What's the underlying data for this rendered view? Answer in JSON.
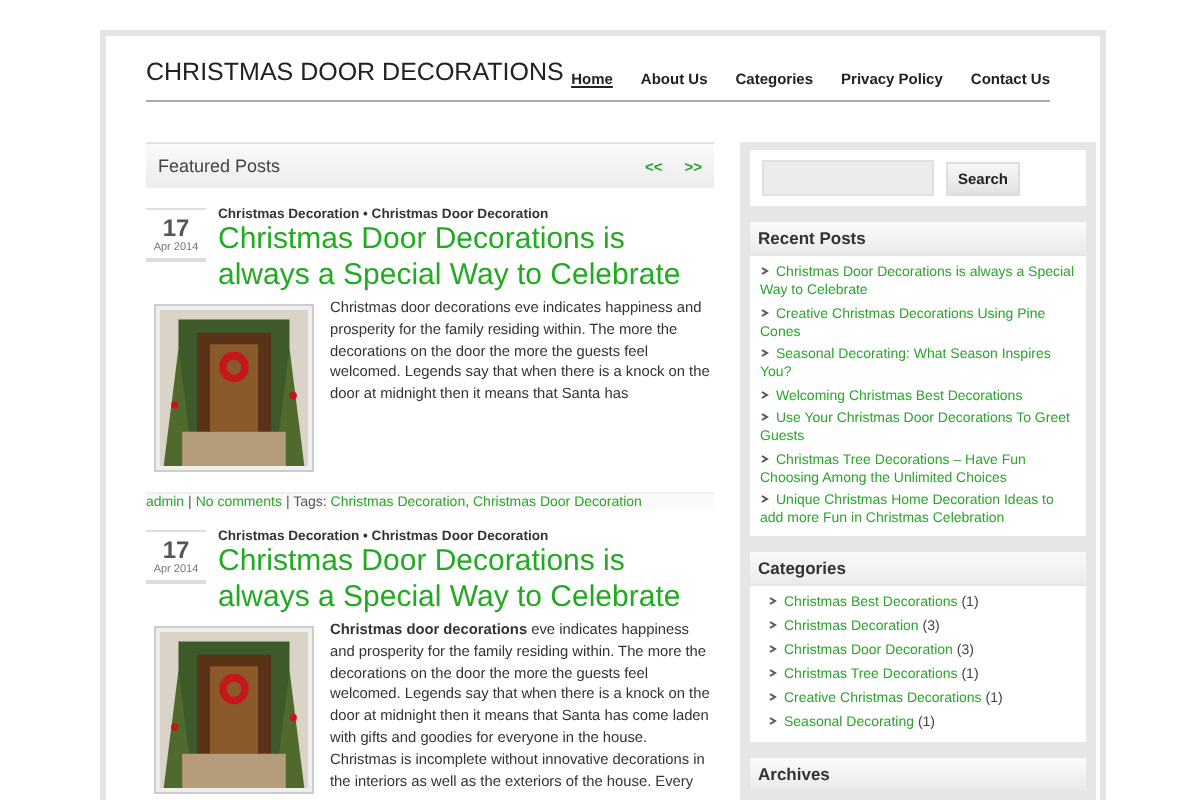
{
  "site_title": "CHRISTMAS DOOR DECORATIONS",
  "nav": [
    {
      "label": "Home",
      "selected": true
    },
    {
      "label": "About Us",
      "selected": false
    },
    {
      "label": "Categories",
      "selected": false
    },
    {
      "label": "Privacy Policy",
      "selected": false
    },
    {
      "label": "Contact Us",
      "selected": false
    }
  ],
  "featured": {
    "title": "Featured Posts",
    "prev": "<<",
    "next": ">>"
  },
  "posts": [
    {
      "day": "17",
      "month": "Apr 2014",
      "categories": [
        "Christmas Decoration",
        "Christmas Door Decoration"
      ],
      "separator": "•",
      "title": "Christmas Door Decorations is always a Special Way to Celebrate",
      "excerpt": "Christmas door decorations eve indicates happiness and prosperity for the family residing within. The more the decorations on the door the more the guests feel welcomed. Legends say that when there is a knock on the door at midnight then it means that Santa has",
      "meta": {
        "author": "admin",
        "separator": "|",
        "comments": "No comments",
        "tags_label": "| Tags:",
        "tags": [
          "Christmas Decoration",
          "Christmas Door Decoration"
        ],
        "tag_separator": ","
      }
    },
    {
      "day": "17",
      "month": "Apr 2014",
      "categories": [
        "Christmas Decoration",
        "Christmas Door Decoration"
      ],
      "separator": "•",
      "title": "Christmas Door Decorations is always a Special Way to Celebrate",
      "excerpt": "**Christmas door decorations** eve indicates happiness and prosperity for the family residing within. The more the decorations on the door the more the guests feel welcomed. Legends say that when there is a knock on the door at midnight then it means that Santa has come laden with gifts and goodies for everyone in the house. Christmas is incomplete without innovative decorations in the interiors as well as the exteriors of the house. Every"
    }
  ],
  "sidebar": {
    "search_button": "Search",
    "recent_posts": {
      "title": "Recent Posts",
      "items": [
        "Christmas Door Decorations is always a Special Way to Celebrate",
        "Creative Christmas Decorations Using Pine Cones",
        "Seasonal Decorating: What Season Inspires You?",
        "Welcoming Christmas Best Decorations",
        "Use Your Christmas Door Decorations To Greet Guests",
        "Christmas Tree Decorations – Have Fun Choosing Among the Unlimited Choices",
        "Unique Christmas Home Decoration Ideas to add more Fun in Christmas Celebration"
      ]
    },
    "categories": {
      "title": "Categories",
      "items": [
        {
          "label": "Christmas Best Decorations",
          "count": "(1)"
        },
        {
          "label": "Christmas Decoration",
          "count": "(3)"
        },
        {
          "label": "Christmas Door Decoration",
          "count": "(3)"
        },
        {
          "label": "Christmas Tree Decorations",
          "count": "(1)"
        },
        {
          "label": "Creative Christmas Decorations",
          "count": "(1)"
        },
        {
          "label": "Seasonal Decorating",
          "count": "(1)"
        }
      ]
    },
    "archives": {
      "title": "Archives"
    }
  }
}
